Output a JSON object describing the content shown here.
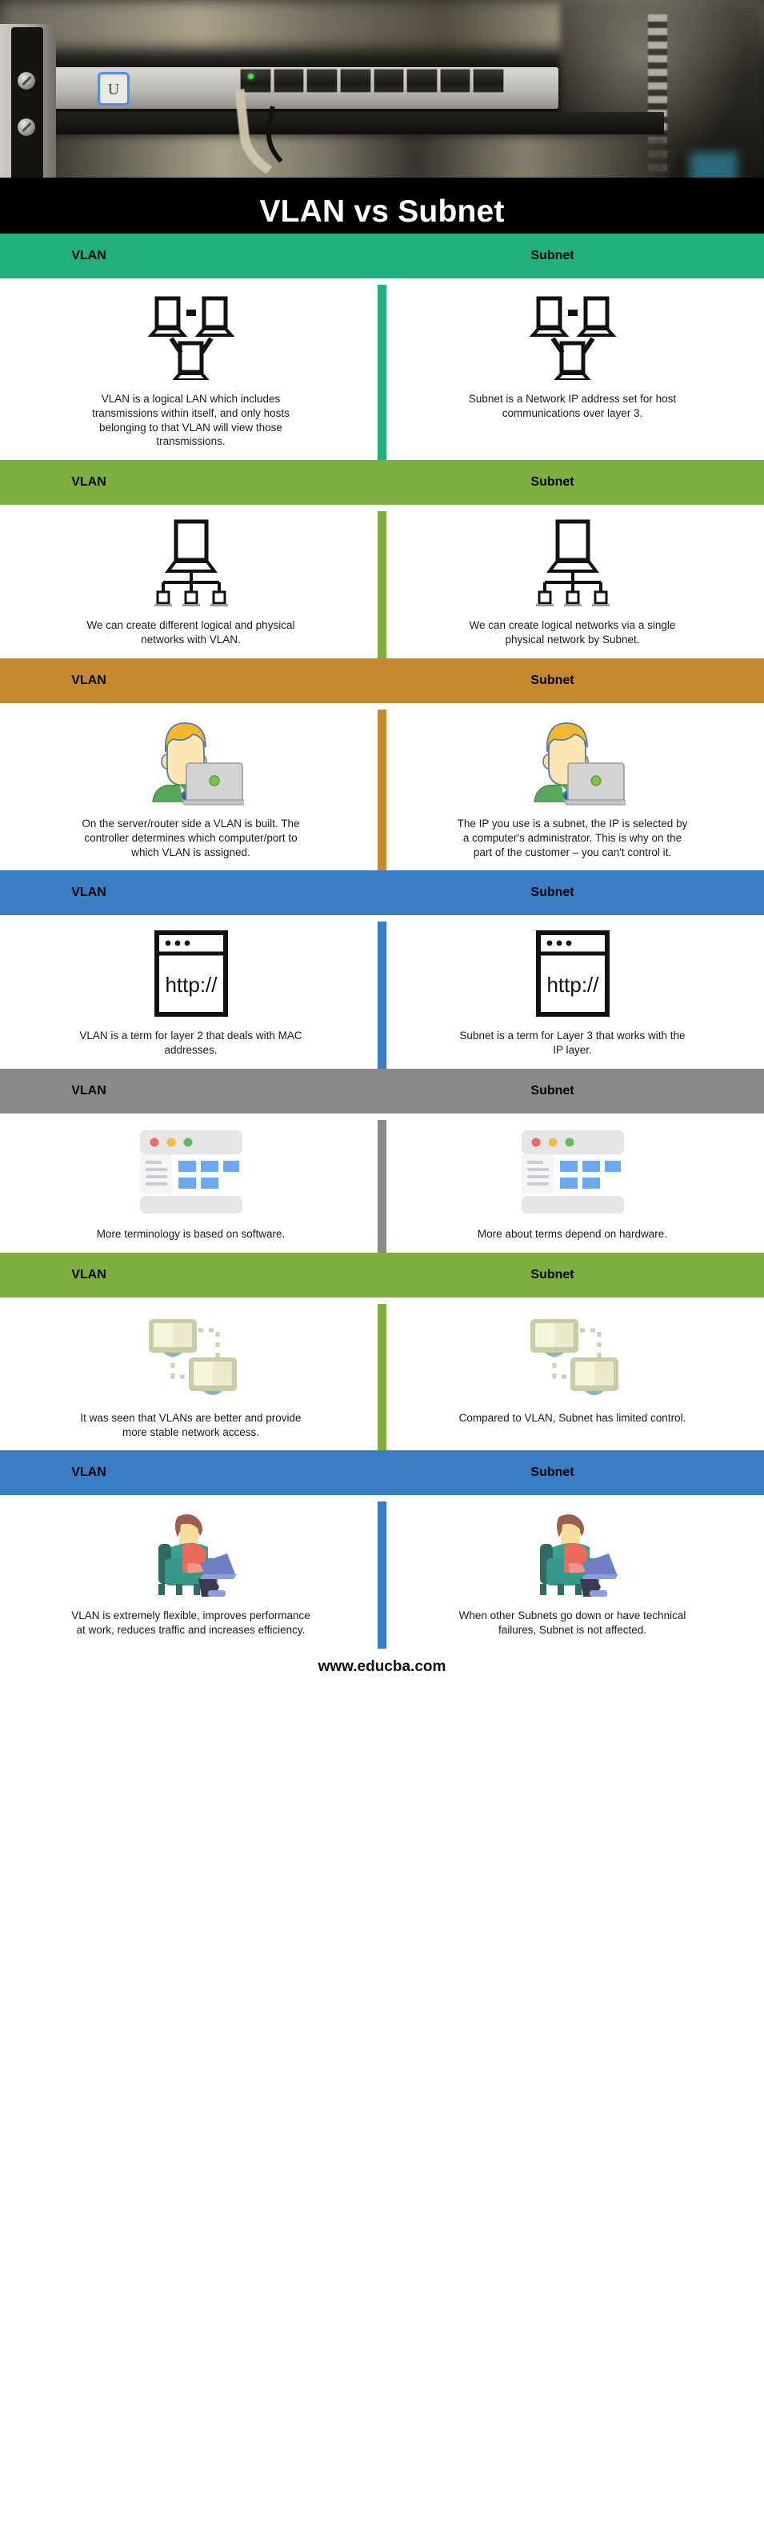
{
  "hero": {
    "alt": "network-switch-in-server-rack-photo",
    "device_label": "U"
  },
  "title": "VLAN vs Subnet",
  "column_labels": {
    "left": "VLAN",
    "right": "Subnet"
  },
  "colors": {
    "title_bg": "#000000",
    "teal": "#22b07d",
    "green": "#7fb03f",
    "gold": "#c68a2e",
    "blue": "#3b7dc4",
    "gray": "#8a8a8a",
    "text": "#1b1b1b"
  },
  "sections": [
    {
      "color": "#22b07d",
      "icon": "network-peer-monitors-icon",
      "left_label": "VLAN",
      "right_label": "Subnet",
      "left_text": "VLAN is a logical LAN which includes transmissions within itself, and only hosts belonging to that VLAN will view those transmissions.",
      "right_text": "Subnet is a Network IP address set for host communications over layer 3."
    },
    {
      "color": "#7fb03f",
      "icon": "network-tree-monitors-icon",
      "left_label": "VLAN",
      "right_label": "Subnet",
      "left_text": "We can create different logical and physical networks with VLAN.",
      "right_text": "We can create logical networks via a single physical network by Subnet."
    },
    {
      "color": "#c68a2e",
      "icon": "person-with-laptop-icon",
      "left_label": "VLAN",
      "right_label": "Subnet",
      "left_text": "On the server/router side a VLAN is built. The controller determines which computer/port to which VLAN is assigned.",
      "right_text": "The IP you use is a subnet, the IP is selected by a computer's administrator. This is why on the part of the customer – you can't control it."
    },
    {
      "color": "#3b7dc4",
      "icon": "browser-http-icon",
      "icon_text": "http://",
      "left_label": "VLAN",
      "right_label": "Subnet",
      "left_text": "VLAN is a term for layer 2 that deals with MAC addresses.",
      "right_text": "Subnet is a term for Layer 3 that works with the IP layer."
    },
    {
      "color": "#8a8a8a",
      "icon": "browser-dashboard-wireframe-icon",
      "left_label": "VLAN",
      "right_label": "Subnet",
      "left_text": "More terminology is based on software.",
      "right_text": "More about terms depend on hardware."
    },
    {
      "color": "#7fb03f",
      "icon": "connected-monitors-dashed-icon",
      "left_label": "VLAN",
      "right_label": "Subnet",
      "left_text": "It was seen that VLANs are better and provide more stable network access.",
      "right_text": "Compared to VLAN, Subnet has limited control."
    },
    {
      "color": "#3b7dc4",
      "icon": "person-in-armchair-laptop-icon",
      "left_label": "VLAN",
      "right_label": "Subnet",
      "left_text": "VLAN is extremely flexible, improves performance at work, reduces traffic and increases efficiency.",
      "right_text": "When other Subnets go down or have technical failures, Subnet is not affected."
    }
  ],
  "footer": {
    "website": "www.educba.com"
  }
}
